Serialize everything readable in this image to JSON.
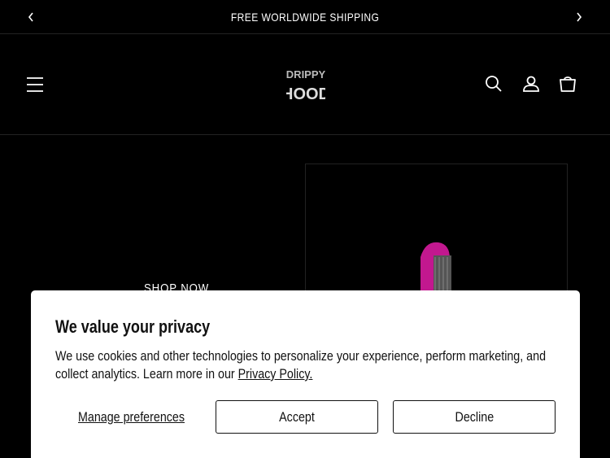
{
  "announcement": {
    "text": "FREE WORLDWIDE SHIPPING"
  },
  "header": {
    "logo_text": [
      "DRIPPY",
      "HOOD"
    ],
    "icons": [
      "menu-icon",
      "search-icon",
      "account-icon",
      "cart-icon"
    ]
  },
  "hero": {
    "cta_label": "SHOP NOW"
  },
  "cookie_banner": {
    "title": "We value your privacy",
    "body": "We use cookies and other technologies to personalize your experience, perform marketing, and collect analytics. Learn more in our ",
    "policy_link": "Privacy Policy.",
    "manage_label": "Manage preferences",
    "accept_label": "Accept",
    "decline_label": "Decline"
  },
  "colors": {
    "background": "#000000",
    "modal": "#ffffff",
    "product_accent": "#c2188f"
  }
}
